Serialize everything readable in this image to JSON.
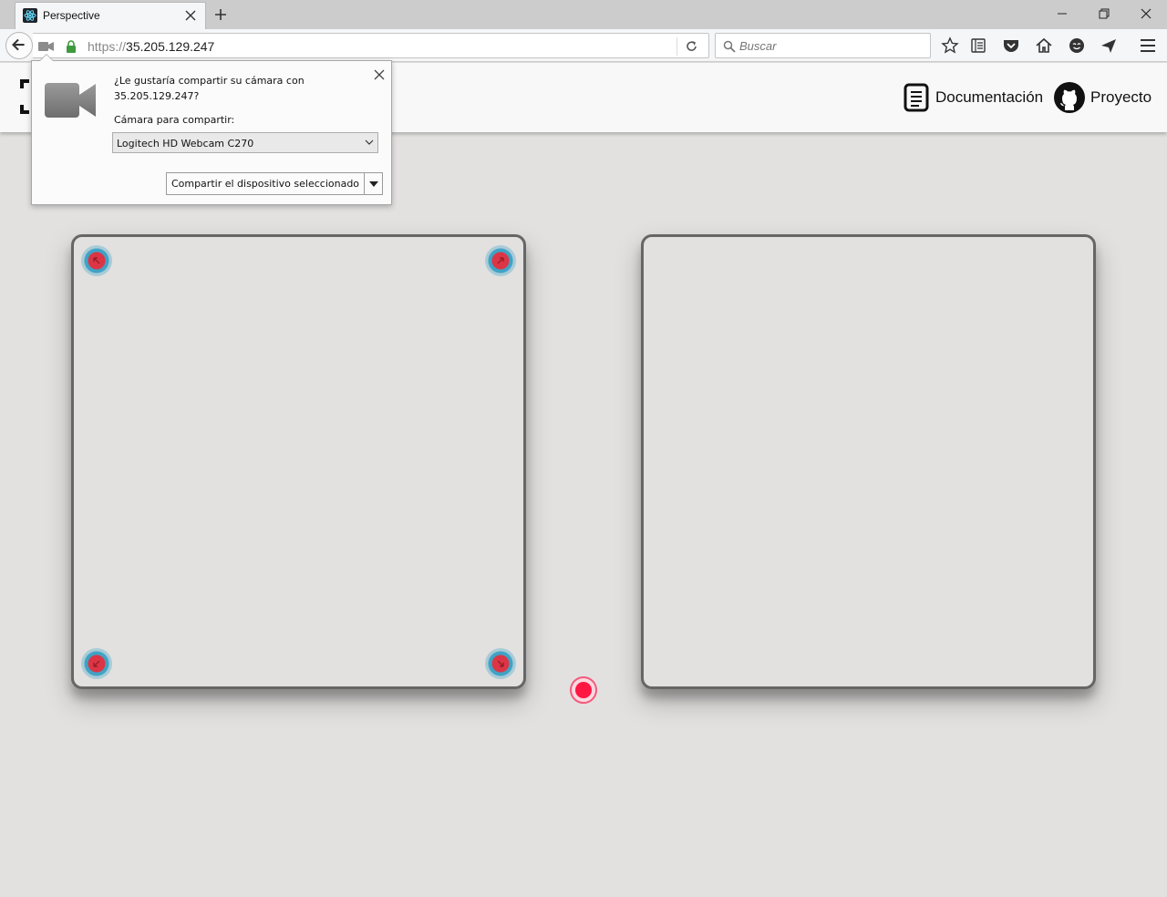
{
  "browser": {
    "tab_title": "Perspective",
    "url_protocol": "https://",
    "url_host": "35.205.129.247",
    "search_placeholder": "Buscar",
    "icons": [
      "react-favicon-icon",
      "close-icon",
      "plus-icon",
      "minimize-icon",
      "restore-icon",
      "close-window-icon",
      "back-arrow-icon",
      "camera-icon",
      "lock-icon",
      "reload-icon",
      "search-icon",
      "star-icon",
      "reading-list-icon",
      "pocket-icon",
      "home-icon",
      "chat-icon",
      "send-icon",
      "menu-icon"
    ]
  },
  "header": {
    "docs_label": "Documentación",
    "project_label": "Proyecto",
    "icons": [
      "logo-icon",
      "document-icon",
      "github-icon"
    ]
  },
  "popup": {
    "question": "¿Le gustaría compartir su cámara con 35.205.129.247?",
    "camera_label": "Cámara para compartir:",
    "selected_camera": "Logitech HD Webcam C270",
    "share_button": "Compartir el dispositivo seleccionado"
  },
  "colors": {
    "page_background": "#e2e1e0",
    "panel_border": "#666666",
    "handle_core": "#dc3545",
    "handle_ring": "#3fa3c6",
    "capture_button": "#ff1744",
    "lock_green": "#3d9a3d"
  }
}
